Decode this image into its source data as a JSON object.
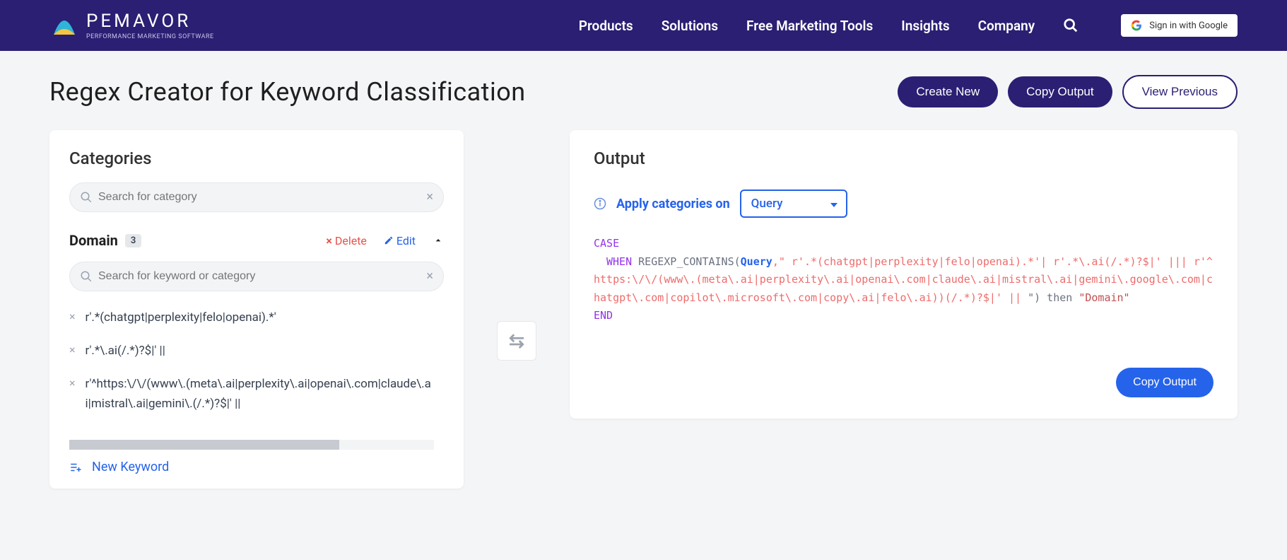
{
  "header": {
    "brand": "PEMAVOR",
    "tagline": "PERFORMANCE MARKETING SOFTWARE",
    "nav": {
      "products": "Products",
      "solutions": "Solutions",
      "tools": "Free Marketing Tools",
      "insights": "Insights",
      "company": "Company"
    },
    "signin": "Sign in with Google"
  },
  "page": {
    "title": "Regex Creator for Keyword Classification",
    "create_new": "Create New",
    "copy_output": "Copy Output",
    "view_previous": "View Previous"
  },
  "categories": {
    "title": "Categories",
    "search_placeholder": "Search for category",
    "current": {
      "name": "Domain",
      "count": "3",
      "delete": "Delete",
      "edit": "Edit",
      "kw_search_placeholder": "Search for keyword or category",
      "keywords": [
        "r'.*(chatgpt|perplexity|felo|openai).*'",
        "r'.*\\.ai(/.*)?$|' ||",
        "r'^https:\\/\\/(www\\.(meta\\.ai|perplexity\\.ai|openai\\.com|claude\\.ai|mistral\\.ai|gemini\\.(/.*)?$|' ||"
      ],
      "new_keyword": "New Keyword"
    }
  },
  "output": {
    "title": "Output",
    "apply_label": "Apply categories on",
    "apply_value": "Query",
    "code": {
      "case": "CASE",
      "when": "WHEN",
      "fn_open": " REGEXP_CONTAINS(",
      "query_token": "Query",
      "regex_part1": ",\" r'.*(chatgpt|perplexity|felo|openai).*'| r'.*\\.ai(/.*)?$|' ||| r'^https:\\/\\/(www\\.(meta\\.ai|perplexity\\.ai|openai\\.com|claude\\.ai|mistral\\.ai|gemini\\.google\\.com|chatgpt\\.com|copilot\\.microsoft\\.com|copy\\.ai|felo\\.ai))(/.*)?$|' || ",
      "then": "\") then ",
      "result": "\"Domain\"",
      "end": "END"
    },
    "copy_button": "Copy Output"
  }
}
